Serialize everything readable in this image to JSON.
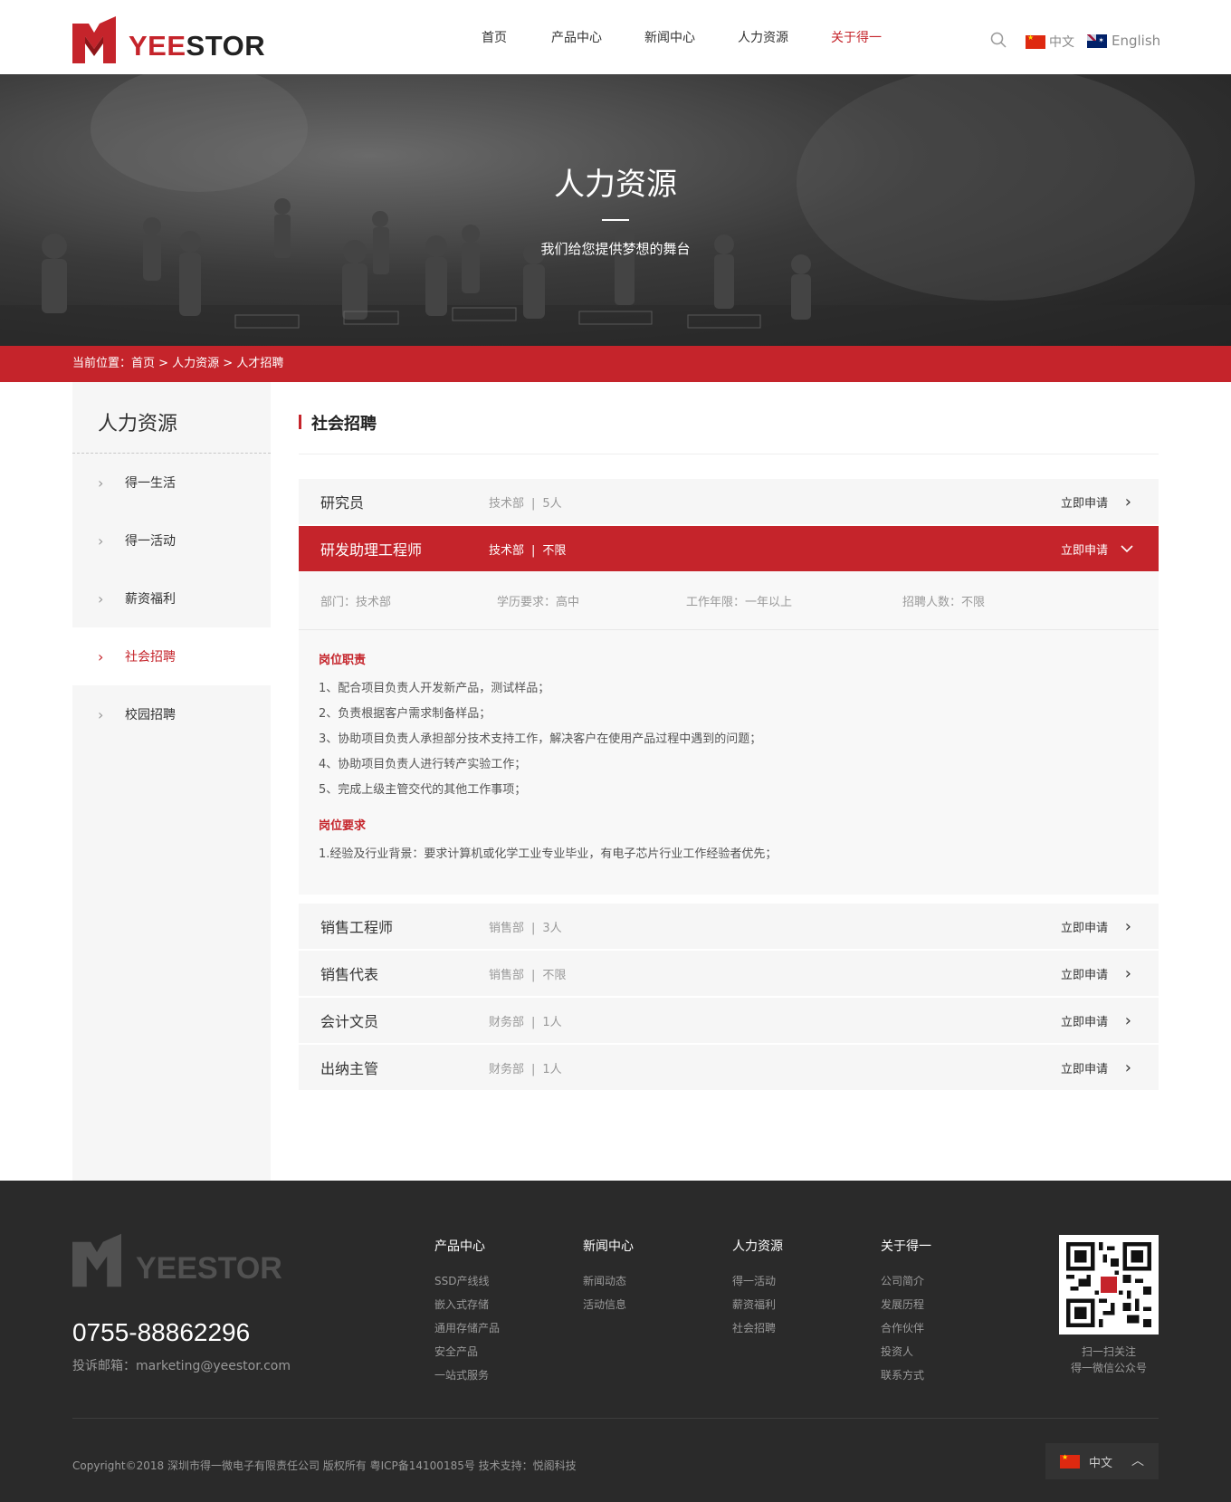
{
  "header": {
    "logo_text_red": "YEE",
    "logo_text_dark": "STOR",
    "nav": [
      {
        "label": "首页",
        "active": false
      },
      {
        "label": "产品中心",
        "active": false
      },
      {
        "label": "新闻中心",
        "active": false
      },
      {
        "label": "人力资源",
        "active": false
      },
      {
        "label": "关于得一",
        "active": true
      }
    ],
    "lang_cn": "中文",
    "lang_en": "English",
    "accent_color": "#c5242b"
  },
  "banner": {
    "title": "人力资源",
    "subtitle": "我们给您提供梦想的舞台"
  },
  "breadcrumb": {
    "text": "当前位置：首页 > 人力资源 > 人才招聘"
  },
  "sidebar": {
    "title": "人力资源",
    "items": [
      {
        "label": "得一生活",
        "active": false
      },
      {
        "label": "得一活动",
        "active": false
      },
      {
        "label": "薪资福利",
        "active": false
      },
      {
        "label": "社会招聘",
        "active": true
      },
      {
        "label": "校园招聘",
        "active": false
      }
    ]
  },
  "section": {
    "title": "社会招聘",
    "apply_label": "立即申请"
  },
  "jobs": [
    {
      "name": "研究员",
      "dept": "技术部",
      "count": "5人",
      "open": false
    },
    {
      "name": "研发助理工程师",
      "dept": "技术部",
      "count": "不限",
      "open": true
    },
    {
      "name": "销售工程师",
      "dept": "销售部",
      "count": "3人",
      "open": false
    },
    {
      "name": "销售代表",
      "dept": "销售部",
      "count": "不限",
      "open": false
    },
    {
      "name": "会计文员",
      "dept": "财务部",
      "count": "1人",
      "open": false
    },
    {
      "name": "出纳主管",
      "dept": "财务部",
      "count": "1人",
      "open": false
    }
  ],
  "detail": {
    "dept": "部门：技术部",
    "education": "学历要求：高中",
    "experience": "工作年限：一年以上",
    "headcount": "招聘人数：不限",
    "duty_title": "岗位职责",
    "duties": [
      "1、配合项目负责人开发新产品，测试样品；",
      "2、负责根据客户需求制备样品；",
      "3、协助项目负责人承担部分技术支持工作，解决客户在使用产品过程中遇到的问题；",
      "4、协助项目负责人进行转产实验工作；",
      "5、完成上级主管交代的其他工作事项；"
    ],
    "req_title": "岗位要求",
    "requirements": [
      "1.经验及行业背景：要求计算机或化学工业专业毕业，有电子芯片行业工作经验者优先；"
    ]
  },
  "footer": {
    "logo_text": "YEESTOR",
    "phone": "0755-88862296",
    "email": "投诉邮箱：marketing@yeestor.com",
    "columns": [
      {
        "title": "产品中心",
        "links": [
          "SSD产线线",
          "嵌入式存储",
          "通用存储产品",
          "安全产品",
          "一站式服务"
        ]
      },
      {
        "title": "新闻中心",
        "links": [
          "新闻动态",
          "活动信息"
        ]
      },
      {
        "title": "人力资源",
        "links": [
          "得一活动",
          "薪资福利",
          "社会招聘"
        ]
      },
      {
        "title": "关于得一",
        "links": [
          "公司简介",
          "发展历程",
          "合作伙伴",
          "投资人",
          "联系方式"
        ]
      }
    ],
    "qr_caption_1": "扫一扫关注",
    "qr_caption_2": "得一微信公众号",
    "copyright": "Copyright©2018 深圳市得一微电子有限责任公司 版权所有    粤ICP备14100185号    技术支持：悦阁科技",
    "lang_label": "中文"
  }
}
